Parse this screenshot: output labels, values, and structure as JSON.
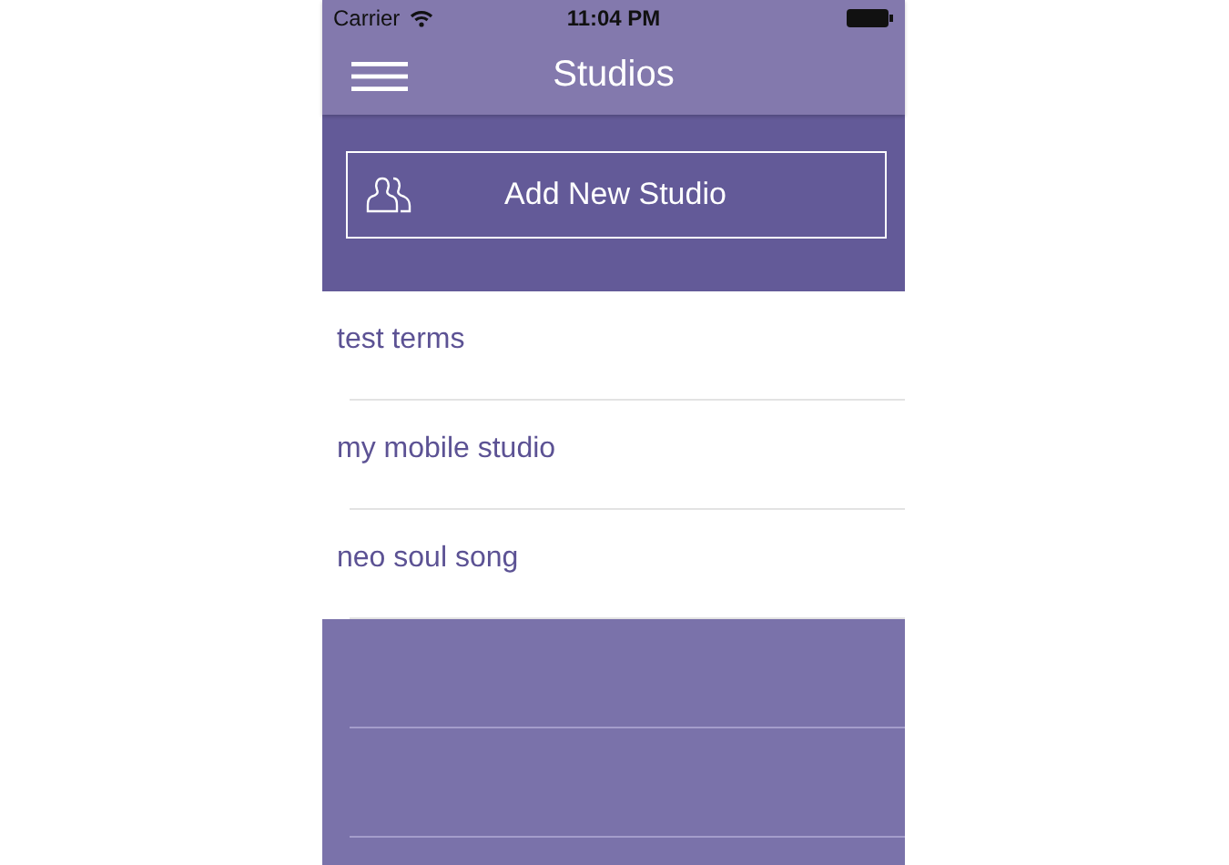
{
  "status_bar": {
    "carrier": "Carrier",
    "time": "11:04 PM"
  },
  "nav_bar": {
    "title": "Studios"
  },
  "add_button": {
    "label": "Add New Studio"
  },
  "studios": [
    {
      "name": "test terms"
    },
    {
      "name": "my mobile studio"
    },
    {
      "name": "neo soul song"
    }
  ]
}
